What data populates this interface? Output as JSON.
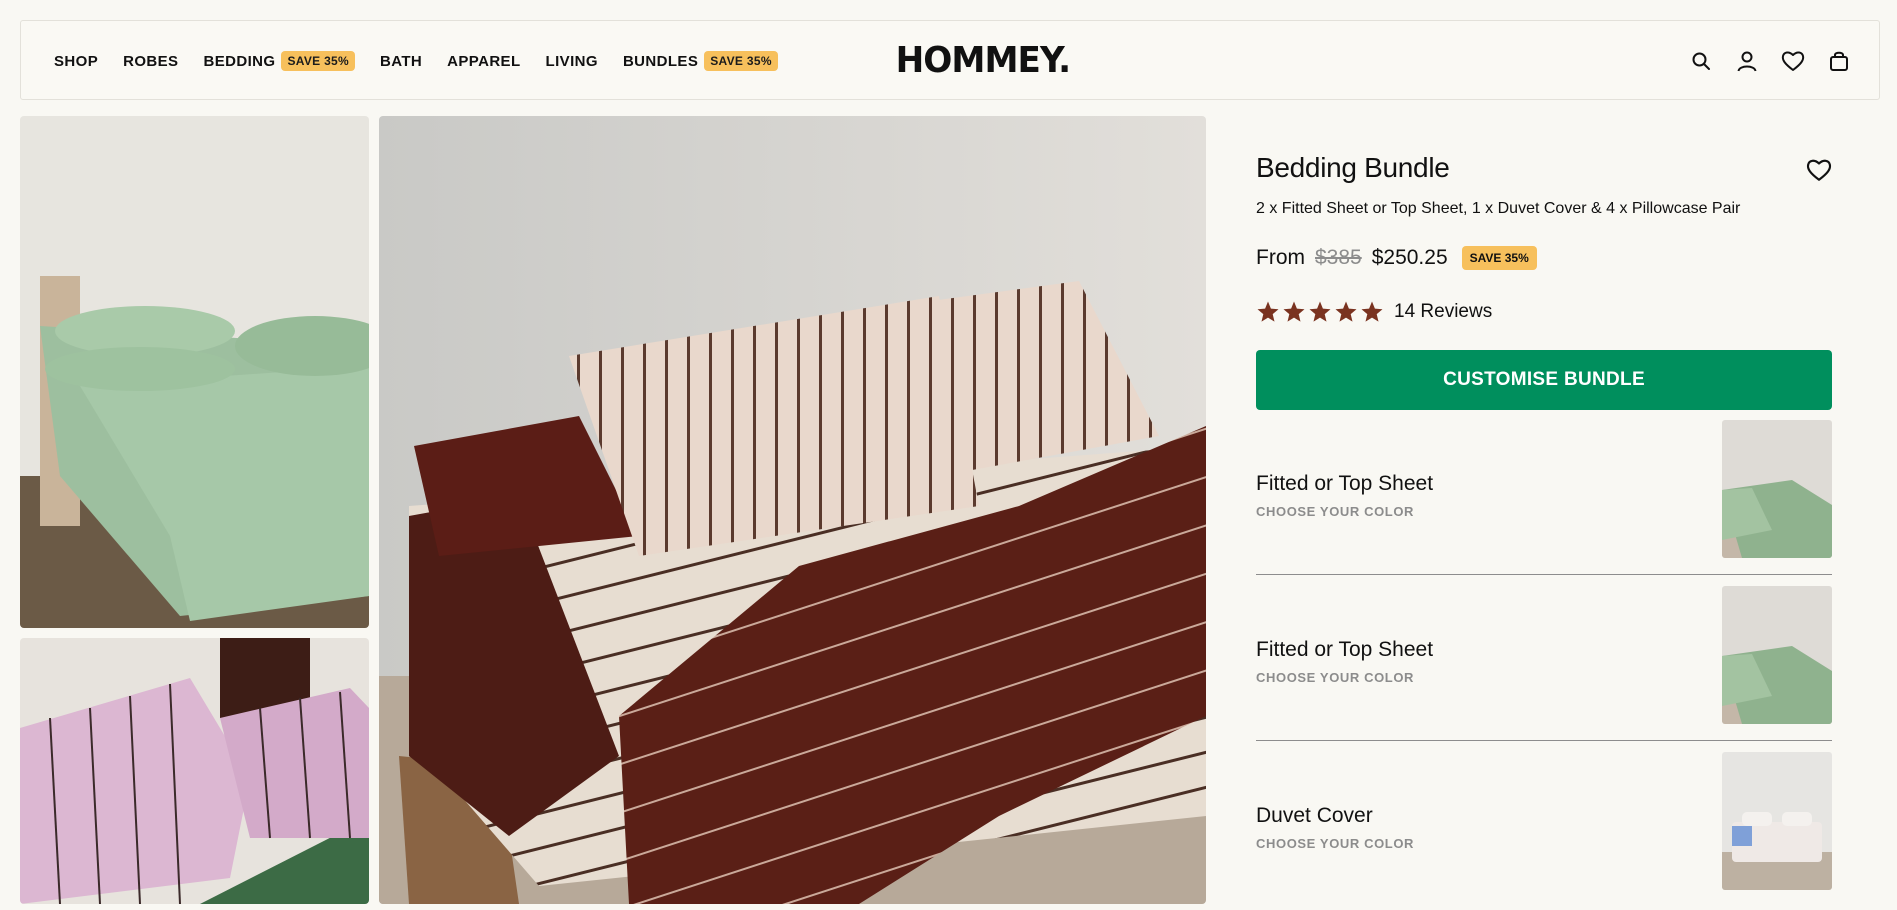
{
  "nav": {
    "items": [
      {
        "label": "SHOP"
      },
      {
        "label": "ROBES"
      },
      {
        "label": "BEDDING",
        "badge": "SAVE 35%"
      },
      {
        "label": "BATH"
      },
      {
        "label": "APPAREL"
      },
      {
        "label": "LIVING"
      },
      {
        "label": "BUNDLES",
        "badge": "SAVE 35%"
      }
    ]
  },
  "brand": {
    "logo": "HOMMEY."
  },
  "header_icons": [
    "search-icon",
    "account-icon",
    "heart-icon",
    "bag-icon"
  ],
  "product": {
    "title": "Bedding Bundle",
    "subtitle": "2 x Fitted Sheet or Top Sheet, 1 x Duvet Cover & 4 x Pillowcase Pair",
    "price_prefix": "From",
    "price_old": "$385",
    "price_new": "$250.25",
    "save_badge": "SAVE 35%",
    "rating": 5,
    "reviews": "14 Reviews",
    "cta": "CUSTOMISE BUNDLE"
  },
  "bundle_items": [
    {
      "name": "Fitted or Top Sheet",
      "sub": "CHOOSE YOUR COLOR"
    },
    {
      "name": "Fitted or Top Sheet",
      "sub": "CHOOSE YOUR COLOR"
    },
    {
      "name": "Duvet Cover",
      "sub": "CHOOSE YOUR COLOR"
    }
  ],
  "colors": {
    "accent_green": "#008f5d",
    "badge_yellow": "#f7c05c",
    "star": "#7a3320",
    "background": "#f9f8f3"
  }
}
